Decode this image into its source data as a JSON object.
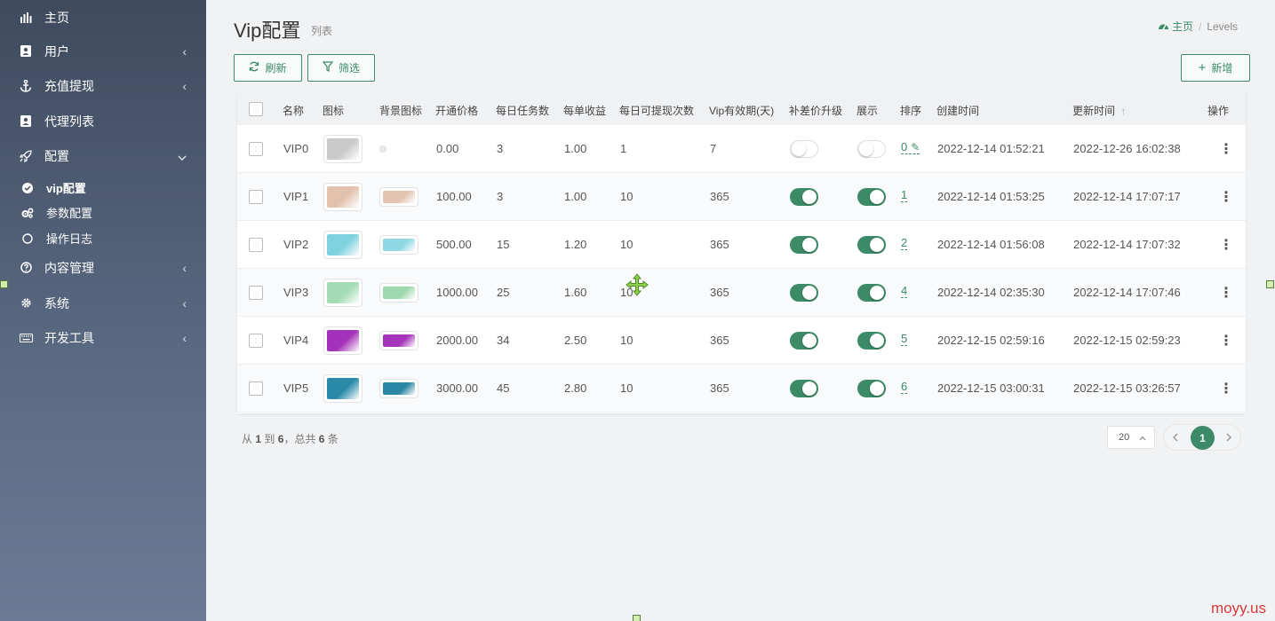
{
  "sidebar": {
    "items": [
      {
        "label": "主页",
        "icon": "bar-chart-icon"
      },
      {
        "label": "用户",
        "icon": "user-card-icon",
        "arrow": "‹"
      },
      {
        "label": "充值提现",
        "icon": "anchor-icon",
        "arrow": "‹"
      },
      {
        "label": "代理列表",
        "icon": "user-card-icon"
      },
      {
        "label": "配置",
        "icon": "rocket-icon",
        "arrow": "⌄"
      },
      {
        "label": "内容管理",
        "icon": "question-circle-icon",
        "arrow": "‹"
      },
      {
        "label": "系统",
        "icon": "gear-icon",
        "arrow": "‹"
      },
      {
        "label": "开发工具",
        "icon": "keyboard-icon",
        "arrow": "‹"
      }
    ],
    "sub_items": [
      {
        "label": "vip配置",
        "icon": "check-circle-icon",
        "active": true
      },
      {
        "label": "参数配置",
        "icon": "gears-icon"
      },
      {
        "label": "操作日志",
        "icon": "circle-icon"
      }
    ]
  },
  "header": {
    "title": "Vip配置",
    "subtitle": "列表",
    "breadcrumb_home": "主页",
    "breadcrumb_sep": "/",
    "breadcrumb_current": "Levels"
  },
  "toolbar": {
    "refresh_label": "刷新",
    "filter_label": "筛选",
    "add_label": "新增"
  },
  "table": {
    "columns": [
      "名称",
      "图标",
      "背景图标",
      "开通价格",
      "每日任务数",
      "每单收益",
      "每日可提现次数",
      "Vip有效期(天)",
      "补差价升级",
      "展示",
      "排序",
      "创建时间",
      "更新时间",
      "操作"
    ],
    "sort_indicator": "↑",
    "rows": [
      {
        "name": "VIP0",
        "price": "0.00",
        "tasks": "3",
        "profit": "1.00",
        "withdraws": "1",
        "validity": "7",
        "upgrade": false,
        "show": false,
        "sort": "0",
        "created": "2022-12-14 01:52:21",
        "updated": "2022-12-26 16:02:38",
        "icon_color": "#c9c9c9",
        "bg_color": null
      },
      {
        "name": "VIP1",
        "price": "100.00",
        "tasks": "3",
        "profit": "1.00",
        "withdraws": "10",
        "validity": "365",
        "upgrade": true,
        "show": true,
        "sort": "1",
        "created": "2022-12-14 01:53:25",
        "updated": "2022-12-14 17:07:17",
        "icon_color": "#e2c2ad",
        "bg_color": "#e3c4b0"
      },
      {
        "name": "VIP2",
        "price": "500.00",
        "tasks": "15",
        "profit": "1.20",
        "withdraws": "10",
        "validity": "365",
        "upgrade": true,
        "show": true,
        "sort": "2",
        "created": "2022-12-14 01:56:08",
        "updated": "2022-12-14 17:07:32",
        "icon_color": "#7fd3df",
        "bg_color": "#8fd8e3"
      },
      {
        "name": "VIP3",
        "price": "1000.00",
        "tasks": "25",
        "profit": "1.60",
        "withdraws": "10",
        "validity": "365",
        "upgrade": true,
        "show": true,
        "sort": "4",
        "created": "2022-12-14 02:35:30",
        "updated": "2022-12-14 17:07:46",
        "icon_color": "#a3dcb4",
        "bg_color": "#9ed8ae"
      },
      {
        "name": "VIP4",
        "price": "2000.00",
        "tasks": "34",
        "profit": "2.50",
        "withdraws": "10",
        "validity": "365",
        "upgrade": true,
        "show": true,
        "sort": "5",
        "created": "2022-12-15 02:59:16",
        "updated": "2022-12-15 02:59:23",
        "icon_color": "#a432b8",
        "bg_color": "#a534bb"
      },
      {
        "name": "VIP5",
        "price": "3000.00",
        "tasks": "45",
        "profit": "2.80",
        "withdraws": "10",
        "validity": "365",
        "upgrade": true,
        "show": true,
        "sort": "6",
        "created": "2022-12-15 03:00:31",
        "updated": "2022-12-15 03:26:57",
        "icon_color": "#2a8aa8",
        "bg_color": "#2a87a5"
      }
    ]
  },
  "footer": {
    "summary_from": "从",
    "summary_start": "1",
    "summary_to": "到",
    "summary_end": "6",
    "summary_total": "，总共",
    "summary_count": "6",
    "summary_unit": "条",
    "page_size": "20",
    "current_page": "1"
  },
  "watermark": "moyy.us",
  "colors": {
    "accent": "#3c8a67",
    "sidebar_top": "#3f4a5d",
    "sidebar_bottom": "#6b7b95"
  }
}
